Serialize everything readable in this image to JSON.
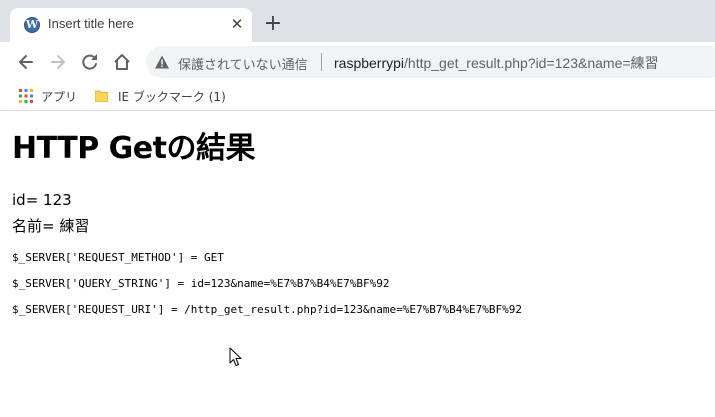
{
  "tab": {
    "title": "Insert title here",
    "close_glyph": "✕",
    "new_tab_glyph": "+"
  },
  "toolbar": {
    "not_secure_label": "保護されていない通信",
    "url_host": "raspberrypi",
    "url_path": "/http_get_result.php?id=123&name=練習"
  },
  "bookmarks": {
    "apps_label": "アプリ",
    "folder_label": "IE ブックマーク (1)"
  },
  "page": {
    "heading": "HTTP Getの結果",
    "id_line": "id= 123",
    "name_line": "名前= 練習",
    "server_lines": [
      "$_SERVER['REQUEST_METHOD'] = GET",
      "$_SERVER['QUERY_STRING'] = id=123&name=%E7%B7%B4%E7%BF%92",
      "$_SERVER['REQUEST_URI'] = /http_get_result.php?id=123&name=%E7%B7%B4%E7%BF%92"
    ]
  },
  "colors": {
    "tabstrip": "#dee1e6",
    "omnibox": "#f1f3f4",
    "icon": "#5f6368",
    "folder": "#f9d65b"
  },
  "icons": {
    "favicon": "wordpress-icon",
    "back": "back-arrow-icon",
    "forward": "forward-arrow-icon",
    "reload": "reload-icon",
    "home": "home-icon",
    "warning": "warning-icon",
    "apps": "apps-grid-icon",
    "folder": "folder-icon",
    "cursor": "mouse-cursor-icon"
  }
}
